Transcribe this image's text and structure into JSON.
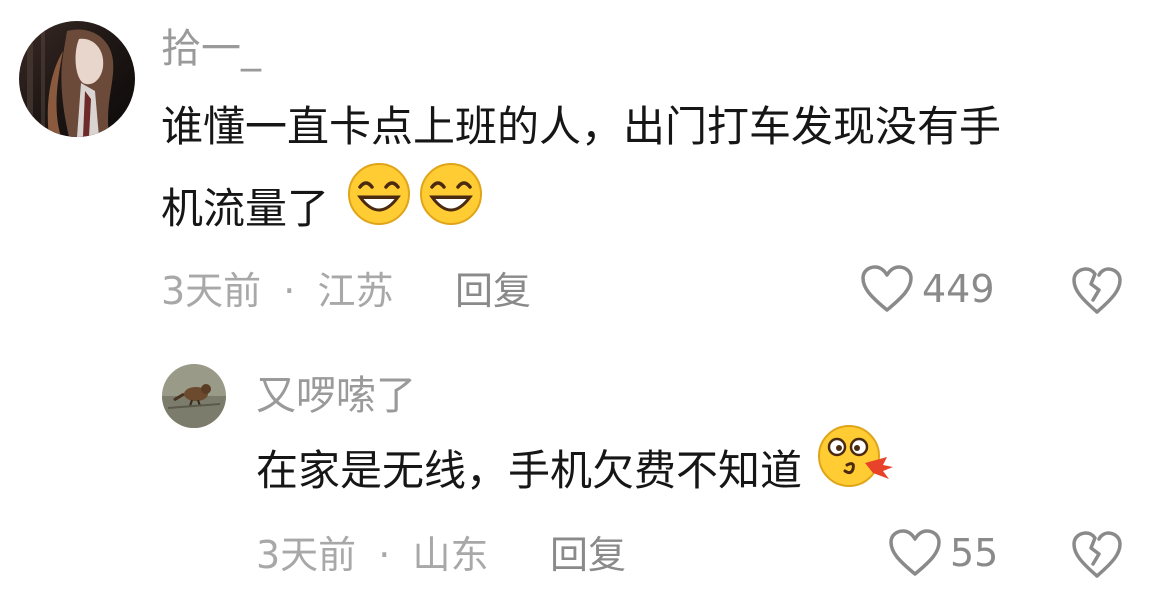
{
  "comments": [
    {
      "username": "拾一_",
      "line1": "谁懂一直卡点上班的人，出门打车发现没有手",
      "line2": "机流量了",
      "emojis": [
        "grinning-emoji",
        "grinning-emoji"
      ],
      "time": "3天前",
      "separator": "·",
      "location": "江苏",
      "reply_label": "回复",
      "likes": "449"
    },
    {
      "username": "又啰嗦了",
      "line1": "在家是无线，手机欠费不知道",
      "emojis": [
        "spitting-emoji"
      ],
      "time": "3天前",
      "separator": "·",
      "location": "山东",
      "reply_label": "回复",
      "likes": "55"
    }
  ],
  "colors": {
    "username": "#9a9a9a",
    "meta": "#a8a8a8",
    "text": "#161616",
    "icon": "#8a8a8a"
  }
}
